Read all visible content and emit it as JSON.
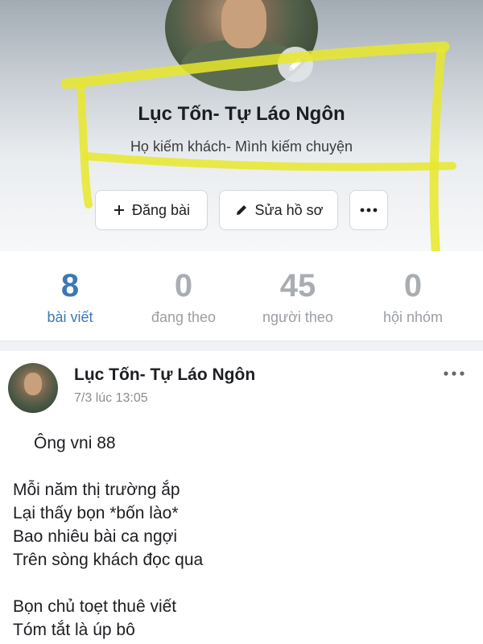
{
  "profile": {
    "name": "Lục Tốn- Tự Láo Ngôn",
    "bio": "Họ kiếm khách- Mình kiếm chuyện"
  },
  "actions": {
    "post_label": "Đăng bài",
    "edit_label": "Sửa hồ sơ",
    "more_label": "···"
  },
  "stats": [
    {
      "value": "8",
      "label": "bài viết"
    },
    {
      "value": "0",
      "label": "đang theo"
    },
    {
      "value": "45",
      "label": "người theo"
    },
    {
      "value": "0",
      "label": "hội nhóm"
    }
  ],
  "post": {
    "author": "Lục Tốn- Tự Láo Ngôn",
    "time": "7/3 lúc 13:05",
    "menu": "···",
    "lines": [
      "Ông vni 88",
      "",
      "Mỗi năm thị trường ắp",
      "Lại thấy bọn *bốn lào*",
      "Bao nhiêu bài ca ngợi",
      "Trên sòng khách đọc qua",
      "",
      "Bọn chủ toẹt thuê viết",
      "Tóm tắt là úp bô"
    ]
  },
  "colors": {
    "accent": "#3b78b5",
    "highlight": "#e8e82a",
    "muted": "#a9adb2"
  },
  "icons": [
    "plus-icon",
    "pencil-icon",
    "more-icon",
    "camera-edit-icon"
  ]
}
